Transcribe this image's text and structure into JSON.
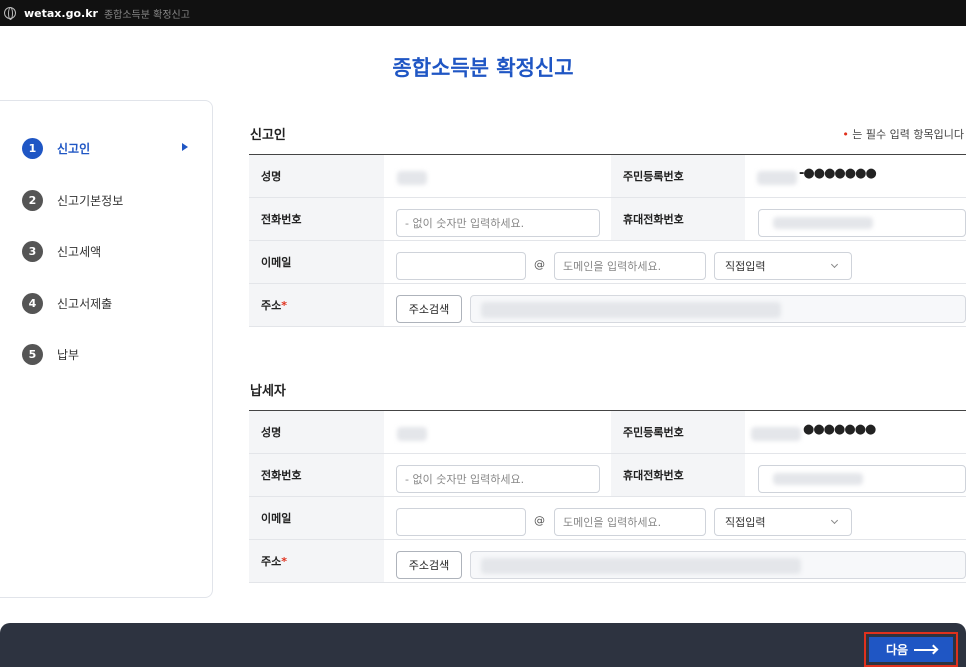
{
  "browser": {
    "domain": "wetax.go.kr",
    "tab_title": "종합소득분 확정신고"
  },
  "page_title": "종합소득분 확정신고",
  "steps": [
    {
      "num": "1",
      "label": "신고인",
      "active": true
    },
    {
      "num": "2",
      "label": "신고기본정보"
    },
    {
      "num": "3",
      "label": "신고세액"
    },
    {
      "num": "4",
      "label": "신고서제출"
    },
    {
      "num": "5",
      "label": "납부"
    }
  ],
  "required_note": {
    "dot": "•",
    "text": " 는 필수 입력 항목입니다"
  },
  "sections": [
    {
      "title": "신고인",
      "labels": {
        "name": "성명",
        "rrn": "주민등록번호",
        "phone": "전화번호",
        "mobile": "휴대전화번호",
        "email": "이메일",
        "address": "주소"
      },
      "rrn_masked": "-●●●●●●●",
      "phone_placeholder": "- 없이 숫자만 입력하세요.",
      "email_at": "@",
      "domain_placeholder": "도메인을 입력하세요.",
      "domain_select": "직접입력",
      "address_button": "주소검색",
      "required_mark": "*"
    },
    {
      "title": "납세자",
      "labels": {
        "name": "성명",
        "rrn": "주민등록번호",
        "phone": "전화번호",
        "mobile": "휴대전화번호",
        "email": "이메일",
        "address": "주소"
      },
      "rrn_masked": "●●●●●●●",
      "phone_placeholder": "- 없이 숫자만 입력하세요.",
      "email_at": "@",
      "domain_placeholder": "도메인을 입력하세요.",
      "domain_select": "직접입력",
      "address_button": "주소검색",
      "required_mark": "*"
    }
  ],
  "footer": {
    "next_label": "다음"
  },
  "colors": {
    "primary": "#1f56c4",
    "required": "#e0311d",
    "footer": "#2d3340"
  }
}
